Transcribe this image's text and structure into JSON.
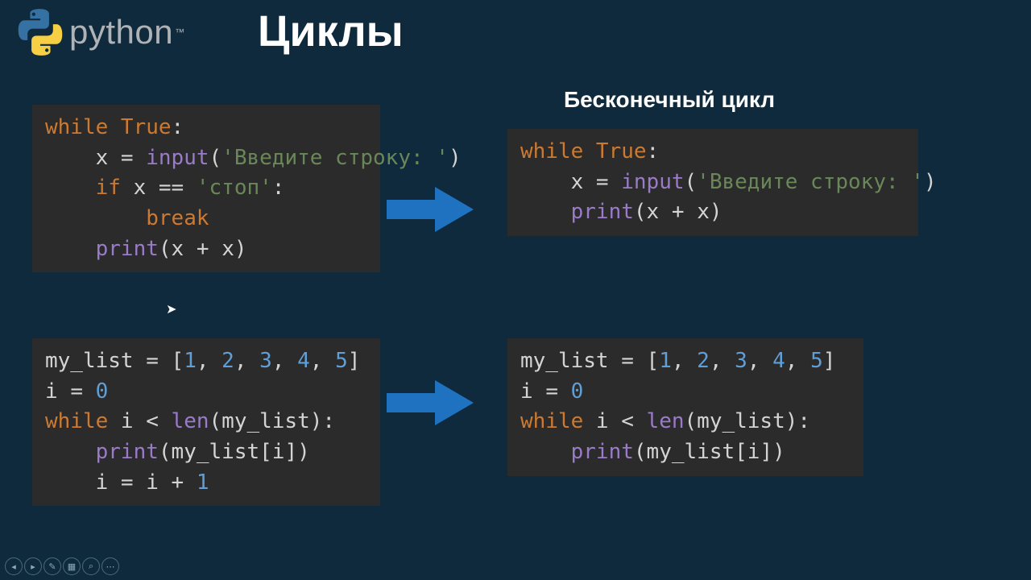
{
  "header": {
    "logo_word": "python",
    "tm": "™"
  },
  "title": "Циклы",
  "subtitle": "Бесконечный цикл",
  "code": {
    "box1": {
      "l1a": "while ",
      "l1b": "True",
      "l1c": ":",
      "l2a": "    x ",
      "l2b": "= ",
      "l2c": "input",
      "l2d": "(",
      "l2e": "'Введите строку: '",
      "l2f": ")",
      "l3a": "    ",
      "l3b": "if ",
      "l3c": "x ",
      "l3d": "== ",
      "l3e": "'стоп'",
      "l3f": ":",
      "l4a": "        ",
      "l4b": "break",
      "l5a": "    ",
      "l5b": "print",
      "l5c": "(x ",
      "l5d": "+ ",
      "l5e": "x)"
    },
    "box2": {
      "l1a": "my_list ",
      "l1b": "= [",
      "l1c": "1",
      "l1d": ", ",
      "l1e": "2",
      "l1f": ", ",
      "l1g": "3",
      "l1h": ", ",
      "l1i": "4",
      "l1j": ", ",
      "l1k": "5",
      "l1l": "]",
      "l2a": "i ",
      "l2b": "= ",
      "l2c": "0",
      "l3a": "while ",
      "l3b": "i ",
      "l3c": "< ",
      "l3d": "len",
      "l3e": "(my_list):",
      "l4a": "    ",
      "l4b": "print",
      "l4c": "(my_list[i])",
      "l5a": "    i ",
      "l5b": "= ",
      "l5c": "i ",
      "l5d": "+ ",
      "l5e": "1"
    },
    "box3": {
      "l1a": "while ",
      "l1b": "True",
      "l1c": ":",
      "l2a": "    x ",
      "l2b": "= ",
      "l2c": "input",
      "l2d": "(",
      "l2e": "'Введите строку: '",
      "l2f": ")",
      "l3a": "    ",
      "l3b": "print",
      "l3c": "(x ",
      "l3d": "+ ",
      "l3e": "x)"
    },
    "box4": {
      "l1a": "my_list ",
      "l1b": "= [",
      "l1c": "1",
      "l1d": ", ",
      "l1e": "2",
      "l1f": ", ",
      "l1g": "3",
      "l1h": ", ",
      "l1i": "4",
      "l1j": ", ",
      "l1k": "5",
      "l1l": "]",
      "l2a": "i ",
      "l2b": "= ",
      "l2c": "0",
      "l3a": "while ",
      "l3b": "i ",
      "l3c": "< ",
      "l3d": "len",
      "l3e": "(my_list):",
      "l4a": "    ",
      "l4b": "print",
      "l4c": "(my_list[i])"
    }
  },
  "toolbar": {
    "b1": "◂",
    "b2": "▸",
    "b3": "✎",
    "b4": "▦",
    "b5": "⌕",
    "b6": "⋯"
  }
}
